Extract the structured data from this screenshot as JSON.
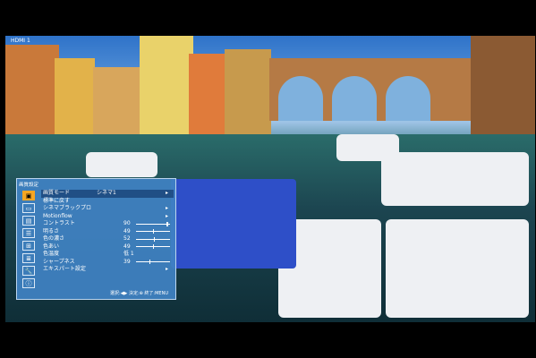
{
  "input_badge": "HDMI 1",
  "menu": {
    "title": "画質設定",
    "icons": [
      "picture-icon",
      "screen-icon",
      "display-icon",
      "setup-icon",
      "function-icon",
      "list-icon",
      "tools-icon",
      "info-icon"
    ],
    "rows": [
      {
        "label": "画質モード",
        "value": "シネマ1",
        "number": "",
        "slider": null,
        "arrow": "▸",
        "selected": true
      },
      {
        "label": "標準に戻す",
        "value": "",
        "number": "",
        "slider": null,
        "arrow": "",
        "selected": false
      },
      {
        "label": "シネマブラックプロ",
        "value": "",
        "number": "",
        "slider": null,
        "arrow": "▸",
        "selected": false
      },
      {
        "label": "Motionflow",
        "value": "",
        "number": "",
        "slider": null,
        "arrow": "▸",
        "selected": false
      },
      {
        "label": "コントラスト",
        "value": "",
        "number": "90",
        "slider": 0.9,
        "arrow": "",
        "selected": false
      },
      {
        "label": "明るさ",
        "value": "",
        "number": "49",
        "slider": 0.49,
        "arrow": "",
        "selected": false
      },
      {
        "label": "色の濃さ",
        "value": "",
        "number": "52",
        "slider": 0.52,
        "arrow": "",
        "selected": false
      },
      {
        "label": "色あい",
        "value": "",
        "number": "49",
        "slider": 0.49,
        "arrow": "",
        "selected": false
      },
      {
        "label": "色温度",
        "value": "",
        "number": "低 1",
        "slider": null,
        "arrow": "",
        "selected": false
      },
      {
        "label": "シャープネス",
        "value": "",
        "number": "39",
        "slider": 0.39,
        "arrow": "",
        "selected": false
      },
      {
        "label": "エキスパート設定",
        "value": "",
        "number": "",
        "slider": null,
        "arrow": "▸",
        "selected": false
      }
    ],
    "footer": "選択:◀▶ 決定:⊕ 終了:MENU"
  }
}
